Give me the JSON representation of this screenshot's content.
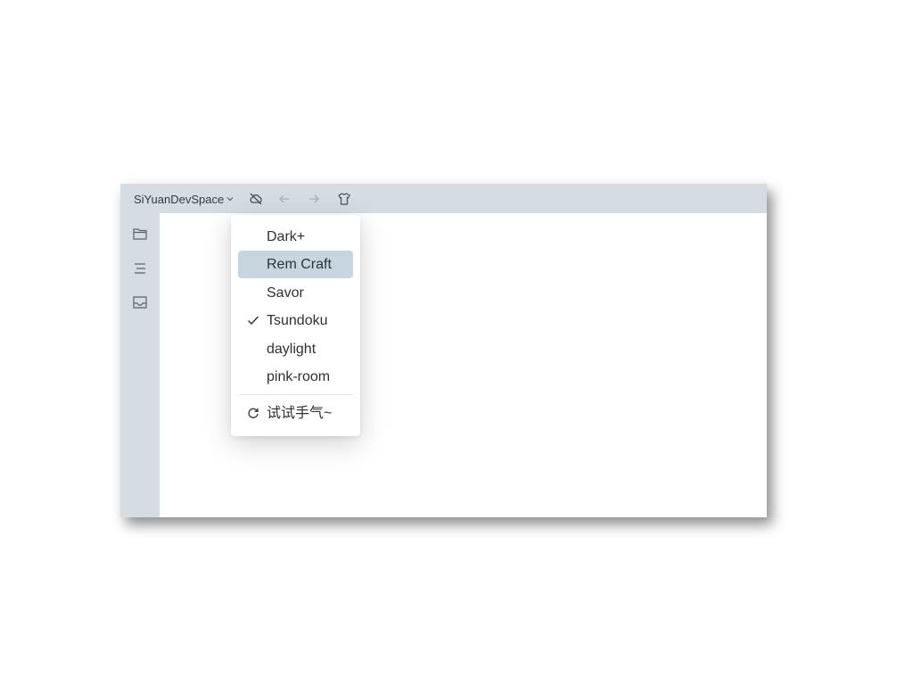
{
  "toolbar": {
    "workspace_label": "SiYuanDevSpace",
    "icons": [
      "cloud-off-icon",
      "back-arrow-icon",
      "forward-arrow-icon",
      "shirt-icon"
    ]
  },
  "sidebar": {
    "icons": [
      "folder-icon",
      "outline-icon",
      "inbox-icon"
    ]
  },
  "theme_menu": {
    "items": [
      {
        "label": "Dark+",
        "checked": false,
        "highlighted": false
      },
      {
        "label": "Rem Craft",
        "checked": false,
        "highlighted": true
      },
      {
        "label": "Savor",
        "checked": false,
        "highlighted": false
      },
      {
        "label": "Tsundoku",
        "checked": true,
        "highlighted": false
      },
      {
        "label": "daylight",
        "checked": false,
        "highlighted": false
      },
      {
        "label": "pink-room",
        "checked": false,
        "highlighted": false
      }
    ],
    "random_label": "试试手气~"
  },
  "colors": {
    "chrome_bg": "#d5dde3",
    "highlight_bg": "#c7d6de",
    "text": "#2c3136"
  }
}
